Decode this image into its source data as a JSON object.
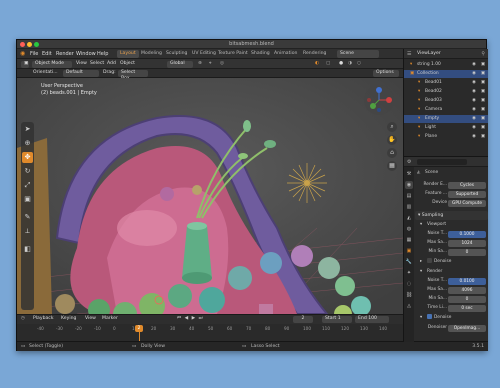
{
  "window": {
    "title": "bitsabmesh.blend"
  },
  "menu": {
    "items": [
      "File",
      "Edit",
      "Render",
      "Window",
      "Help"
    ]
  },
  "workspaces": {
    "tabs": [
      "Layout",
      "Modeling",
      "Sculpting",
      "UV Editing",
      "Texture Paint",
      "Shading",
      "Animation",
      "Rendering"
    ],
    "active": "Layout"
  },
  "scene": {
    "label": "Scene",
    "view_layer": "ViewLayer"
  },
  "header": {
    "mode": "Object Mode",
    "view": "View",
    "select": "Select",
    "add": "Add",
    "object": "Object",
    "transform": "Global",
    "orientation_label": "Orientati...",
    "orientation_value": "Default",
    "drag_label": "Drag:",
    "drag_value": "Select Box",
    "options": "Options"
  },
  "viewport": {
    "line1": "User Perspective",
    "line2": "(2) beads.001 | Empty"
  },
  "outliner": {
    "rows": [
      {
        "label": "string 1.00",
        "selected": false
      },
      {
        "label": "Collection",
        "selected": true
      },
      {
        "label": "Bead01",
        "selected": false
      },
      {
        "label": "Bead02",
        "selected": false
      },
      {
        "label": "Bead03",
        "selected": false
      },
      {
        "label": "Camera",
        "selected": false
      },
      {
        "label": "Empty",
        "selected": true
      },
      {
        "label": "Light",
        "selected": false
      },
      {
        "label": "Plane",
        "selected": false
      }
    ]
  },
  "properties": {
    "scene_label": "Scene",
    "render_engine_label": "Render E...",
    "render_engine_value": "Cycles",
    "feature_label": "Feature ...",
    "feature_value": "Supported",
    "device_label": "Device",
    "device_value": "GPU Compute",
    "sampling": "Sampling",
    "viewport_section": "Viewport",
    "noise_t_label": "Noise T...",
    "noise_t_value": "0.1000",
    "max_sa_label": "Max Sa...",
    "max_sa_value": "1024",
    "min_sa_label": "Min Sa...",
    "min_sa_value": "0",
    "denoise": "Denoise",
    "render_section": "Render",
    "r_noise_value": "0.0100",
    "r_max_value": "4096",
    "r_min_value": "0",
    "time_li_label": "Time Li...",
    "time_li_value": "0 sec",
    "denoise2": "Denoise",
    "denoiser_label": "Denoiser",
    "denoiser_value": "OpenImag..."
  },
  "timeline": {
    "playback": "Playback",
    "keying": "Keying",
    "view": "View",
    "marker": "Marker",
    "current_frame": "2",
    "start_label": "Start",
    "start_value": "1",
    "end_label": "End",
    "end_value": "100",
    "ticks": [
      "-40",
      "-30",
      "-20",
      "-10",
      "0",
      "10",
      "20",
      "30",
      "40",
      "50",
      "60",
      "70",
      "80",
      "90",
      "100",
      "110",
      "120",
      "130",
      "140"
    ],
    "playhead_label": "2"
  },
  "status": {
    "left": "Select (Toggle)",
    "middle": "Dolly View",
    "right": "Lasso Select",
    "version": "3.5.1"
  },
  "colors": {
    "accent": "#e08a2b",
    "selected": "#334d80",
    "field_blue": "#3d5f9a"
  }
}
